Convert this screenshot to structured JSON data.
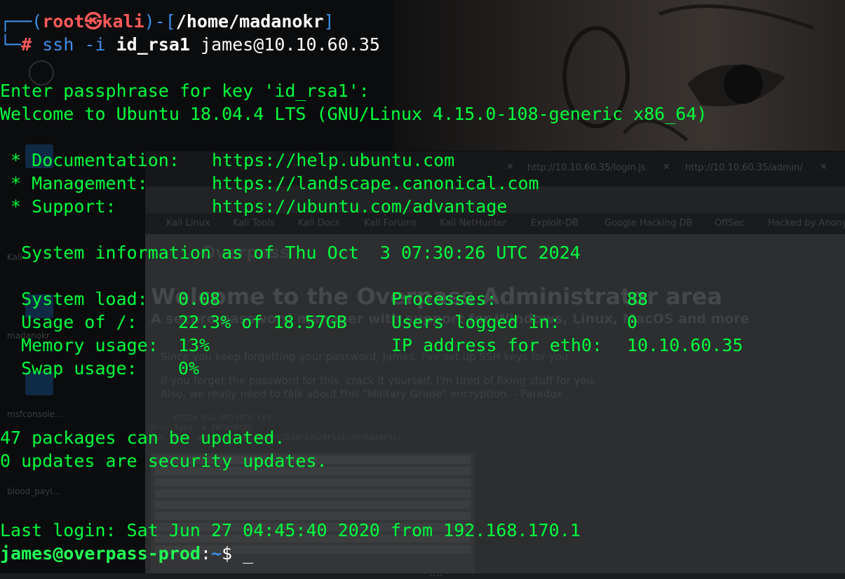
{
  "terminal": {
    "prompt1": {
      "box_top": "┌──(",
      "user": "root",
      "at_icon": "㉿",
      "host": "kali",
      "sep": ")-[",
      "path": "/home/madanokr",
      "close": "]"
    },
    "prompt2": {
      "box_bottom": "└─",
      "hash": "#",
      "cmd": "ssh",
      "flag": "-i",
      "key_file": "id_rsa1",
      "target": "james@10.10.60.35"
    },
    "lines": {
      "passphrase": "Enter passphrase for key 'id_rsa1':",
      "welcome": "Welcome to Ubuntu 18.04.4 LTS (GNU/Linux 4.15.0-108-generic x86_64)",
      "doc_label": " * Documentation:",
      "doc_url": "https://help.ubuntu.com",
      "mgmt_label": " * Management:",
      "mgmt_url": "https://landscape.canonical.com",
      "support_label": " * Support:",
      "support_url": "https://ubuntu.com/advantage",
      "sysinfo": "  System information as of Thu Oct  3 07:30:26 UTC 2024",
      "load_label": "  System load:",
      "load_value": "0.08",
      "proc_label": "Processes:",
      "proc_value": "88",
      "usage_label": "  Usage of /:",
      "usage_value": "22.3% of 18.57GB",
      "users_label": "Users logged in:",
      "users_value": "0",
      "mem_label": "  Memory usage:",
      "mem_value": "13%",
      "ip_label": "IP address for eth0:",
      "ip_value": "10.10.60.35",
      "swap_label": "  Swap usage:",
      "swap_value": "0%",
      "packages": "47 packages can be updated.",
      "security": "0 updates are security updates.",
      "last_login": "Last login: Sat Jun 27 04:45:40 2020 from 192.168.170.1"
    },
    "final_prompt": {
      "user_host": "james@overpass-prod",
      "colon": ":",
      "dir": "~",
      "dollar": "$",
      "cursor": "_"
    }
  },
  "background": {
    "tabs": [
      {
        "url": "http://10.10.60.35/login.js"
      },
      {
        "url": "http://10.10.60.35/admin/"
      }
    ],
    "bookmarks": [
      "Kali Linux",
      "Kali Tools",
      "Kali Docs",
      "Kali Forums",
      "Kali NetHunter",
      "Exploit-DB",
      "Google Hacking DB",
      "OffSec",
      "Hacked by Anonymous"
    ],
    "page_brand": "Overpass",
    "page_title": "Welcome to the Overpass Administrator area",
    "page_subtitle": "A secure password manager with support for Windows, Linux, MacOS and more",
    "page_p1": "Since you keep forgetting your password, James, I've set up SSH keys for you.",
    "page_p2": "If you forget the password for this, crack it yourself. I'm tired of fixing stuff for you.",
    "page_p3": "Also, we really need to talk about this \"Military Grade\" encryption. - Paradox",
    "key_header": "-----BEGIN RSA PRIVATE KEY-----",
    "key_proc": "Proc-Type: 4,ENCRYPTED",
    "key_dek": "DEK-Info: AES-128-CBC,4F50FF2B34F42626F13A7493AB4BF337",
    "desktop_items": [
      "Kali",
      "madanokr",
      "msfconsole...",
      "blood_payl..."
    ]
  }
}
